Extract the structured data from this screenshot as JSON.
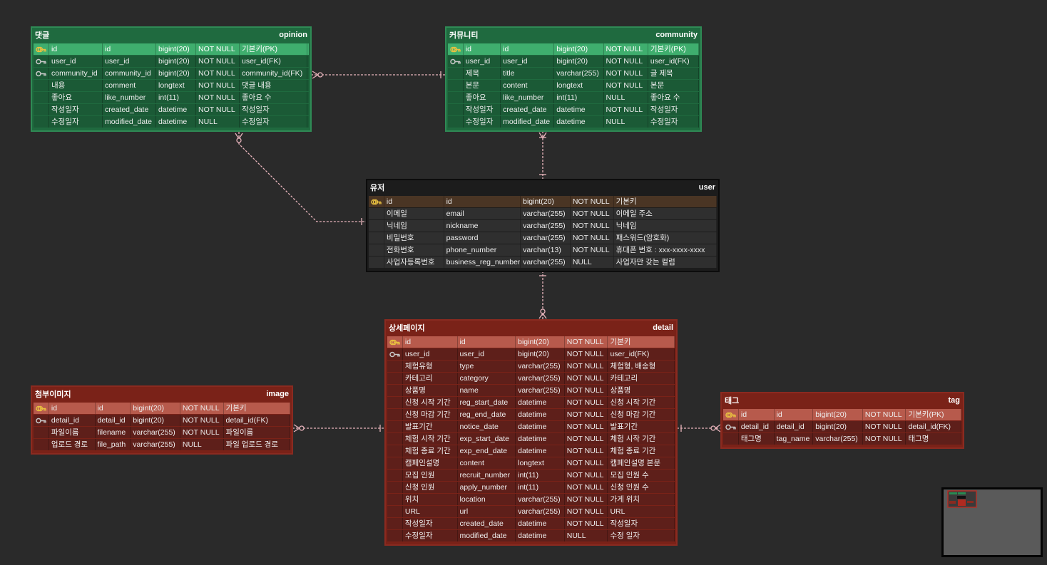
{
  "colors": {
    "green_theme": "#1f6a3f",
    "dark_theme": "#1c1c1c",
    "red_theme": "#7a2218",
    "relation_line": "#e8b4bc",
    "key_icon": "#e8c040"
  },
  "entities": {
    "opinion": {
      "title": "댓글",
      "name": "opinion",
      "rows": [
        {
          "key": "pk",
          "logical": "id",
          "physical": "id",
          "type": "bigint(20)",
          "null": "NOT NULL",
          "comment": "기본키(PK)"
        },
        {
          "key": "fk",
          "logical": "user_id",
          "physical": "user_id",
          "type": "bigint(20)",
          "null": "NOT NULL",
          "comment": "user_id(FK)"
        },
        {
          "key": "fk",
          "logical": "community_id",
          "physical": "community_id",
          "type": "bigint(20)",
          "null": "NOT NULL",
          "comment": "community_id(FK)"
        },
        {
          "key": "",
          "logical": "내용",
          "physical": "comment",
          "type": "longtext",
          "null": "NOT NULL",
          "comment": "댓글 내용"
        },
        {
          "key": "",
          "logical": "좋아요",
          "physical": "like_number",
          "type": "int(11)",
          "null": "NOT NULL",
          "comment": "좋아요 수"
        },
        {
          "key": "",
          "logical": "작성일자",
          "physical": "created_date",
          "type": "datetime",
          "null": "NOT NULL",
          "comment": "작성일자"
        },
        {
          "key": "",
          "logical": "수정일자",
          "physical": "modified_date",
          "type": "datetime",
          "null": "NULL",
          "comment": "수정일자"
        }
      ]
    },
    "community": {
      "title": "커뮤니티",
      "name": "community",
      "rows": [
        {
          "key": "pk",
          "logical": "id",
          "physical": "id",
          "type": "bigint(20)",
          "null": "NOT NULL",
          "comment": "기본키(PK)"
        },
        {
          "key": "fk",
          "logical": "user_id",
          "physical": "user_id",
          "type": "bigint(20)",
          "null": "NOT NULL",
          "comment": "user_id(FK)"
        },
        {
          "key": "",
          "logical": "제목",
          "physical": "title",
          "type": "varchar(255)",
          "null": "NOT NULL",
          "comment": "글 제목"
        },
        {
          "key": "",
          "logical": "본문",
          "physical": "content",
          "type": "longtext",
          "null": "NOT NULL",
          "comment": "본문"
        },
        {
          "key": "",
          "logical": "좋아요",
          "physical": "like_number",
          "type": "int(11)",
          "null": "NULL",
          "comment": "좋아요 수"
        },
        {
          "key": "",
          "logical": "작성일자",
          "physical": "created_date",
          "type": "datetime",
          "null": "NOT NULL",
          "comment": "작성일자"
        },
        {
          "key": "",
          "logical": "수정일자",
          "physical": "modified_date",
          "type": "datetime",
          "null": "NULL",
          "comment": "수정일자"
        }
      ]
    },
    "user": {
      "title": "유저",
      "name": "user",
      "rows": [
        {
          "key": "pk",
          "logical": "id",
          "physical": "id",
          "type": "bigint(20)",
          "null": "NOT NULL",
          "comment": "기본키"
        },
        {
          "key": "",
          "logical": "이메일",
          "physical": "email",
          "type": "varchar(255)",
          "null": "NOT NULL",
          "comment": "이메일 주소"
        },
        {
          "key": "",
          "logical": "닉네임",
          "physical": "nickname",
          "type": "varchar(255)",
          "null": "NOT NULL",
          "comment": "닉네임"
        },
        {
          "key": "",
          "logical": "비밀번호",
          "physical": "password",
          "type": "varchar(255)",
          "null": "NOT NULL",
          "comment": "패스워드(암호화)"
        },
        {
          "key": "",
          "logical": "전화번호",
          "physical": "phone_number",
          "type": "varchar(13)",
          "null": "NOT NULL",
          "comment": "휴대폰 번호 : xxx-xxxx-xxxx"
        },
        {
          "key": "",
          "logical": "사업자등록번호",
          "physical": "business_reg_number",
          "type": "varchar(255)",
          "null": "NULL",
          "comment": "사업자만 갖는 컬럼"
        }
      ]
    },
    "detail": {
      "title": "상세페이지",
      "name": "detail",
      "rows": [
        {
          "key": "pk",
          "logical": "id",
          "physical": "id",
          "type": "bigint(20)",
          "null": "NOT NULL",
          "comment": "기본키"
        },
        {
          "key": "fk",
          "logical": "user_id",
          "physical": "user_id",
          "type": "bigint(20)",
          "null": "NOT NULL",
          "comment": "user_id(FK)"
        },
        {
          "key": "",
          "logical": "체험유형",
          "physical": "type",
          "type": "varchar(255)",
          "null": "NOT NULL",
          "comment": "체험형, 배송형"
        },
        {
          "key": "",
          "logical": "카테고리",
          "physical": "category",
          "type": "varchar(255)",
          "null": "NOT NULL",
          "comment": "카테고리"
        },
        {
          "key": "",
          "logical": "상품명",
          "physical": "name",
          "type": "varchar(255)",
          "null": "NOT NULL",
          "comment": "상품명"
        },
        {
          "key": "",
          "logical": "신청 시작 기간",
          "physical": "reg_start_date",
          "type": "datetime",
          "null": "NOT NULL",
          "comment": "신청 시작 기간"
        },
        {
          "key": "",
          "logical": "신청 마감 기간",
          "physical": "reg_end_date",
          "type": "datetime",
          "null": "NOT NULL",
          "comment": "신청 마감 기간"
        },
        {
          "key": "",
          "logical": "발표기간",
          "physical": "notice_date",
          "type": "datetime",
          "null": "NOT NULL",
          "comment": "발표기간"
        },
        {
          "key": "",
          "logical": "체험 시작 기간",
          "physical": "exp_start_date",
          "type": "datetime",
          "null": "NOT NULL",
          "comment": "체험 시작 기간"
        },
        {
          "key": "",
          "logical": "체험 종료 기간",
          "physical": "exp_end_date",
          "type": "datetime",
          "null": "NOT NULL",
          "comment": "체험 종료 기간"
        },
        {
          "key": "",
          "logical": "캠페인설명",
          "physical": "content",
          "type": "longtext",
          "null": "NOT NULL",
          "comment": "캠페인설명 본문"
        },
        {
          "key": "",
          "logical": "모집 인원",
          "physical": "recruit_number",
          "type": "int(11)",
          "null": "NOT NULL",
          "comment": "모집 인원 수"
        },
        {
          "key": "",
          "logical": "신청 인원",
          "physical": "apply_number",
          "type": "int(11)",
          "null": "NOT NULL",
          "comment": "신청 인원 수"
        },
        {
          "key": "",
          "logical": "위치",
          "physical": "location",
          "type": "varchar(255)",
          "null": "NOT NULL",
          "comment": "가게 위치"
        },
        {
          "key": "",
          "logical": "URL",
          "physical": "url",
          "type": "varchar(255)",
          "null": "NOT NULL",
          "comment": "URL"
        },
        {
          "key": "",
          "logical": "작성일자",
          "physical": "created_date",
          "type": "datetime",
          "null": "NOT NULL",
          "comment": "작성일자"
        },
        {
          "key": "",
          "logical": "수정일자",
          "physical": "modified_date",
          "type": "datetime",
          "null": "NULL",
          "comment": "수정 일자"
        }
      ]
    },
    "image": {
      "title": "첨부이미지",
      "name": "image",
      "rows": [
        {
          "key": "pk",
          "logical": "id",
          "physical": "id",
          "type": "bigint(20)",
          "null": "NOT NULL",
          "comment": "기본키"
        },
        {
          "key": "fk",
          "logical": "detail_id",
          "physical": "detail_id",
          "type": "bigint(20)",
          "null": "NOT NULL",
          "comment": "detail_id(FK)"
        },
        {
          "key": "",
          "logical": "파일이름",
          "physical": "filename",
          "type": "varchar(255)",
          "null": "NOT NULL",
          "comment": "파일이름"
        },
        {
          "key": "",
          "logical": "업로드 경로",
          "physical": "file_path",
          "type": "varchar(255)",
          "null": "NULL",
          "comment": "파일 업로드 경로"
        }
      ]
    },
    "tag": {
      "title": "태그",
      "name": "tag",
      "rows": [
        {
          "key": "pk",
          "logical": "id",
          "physical": "id",
          "type": "bigint(20)",
          "null": "NOT NULL",
          "comment": "기본키(PK)"
        },
        {
          "key": "fk",
          "logical": "detail_id",
          "physical": "detail_id",
          "type": "bigint(20)",
          "null": "NOT NULL",
          "comment": "detail_id(FK)"
        },
        {
          "key": "",
          "logical": "태그명",
          "physical": "tag_name",
          "type": "varchar(255)",
          "null": "NOT NULL",
          "comment": "태그명"
        }
      ]
    }
  }
}
